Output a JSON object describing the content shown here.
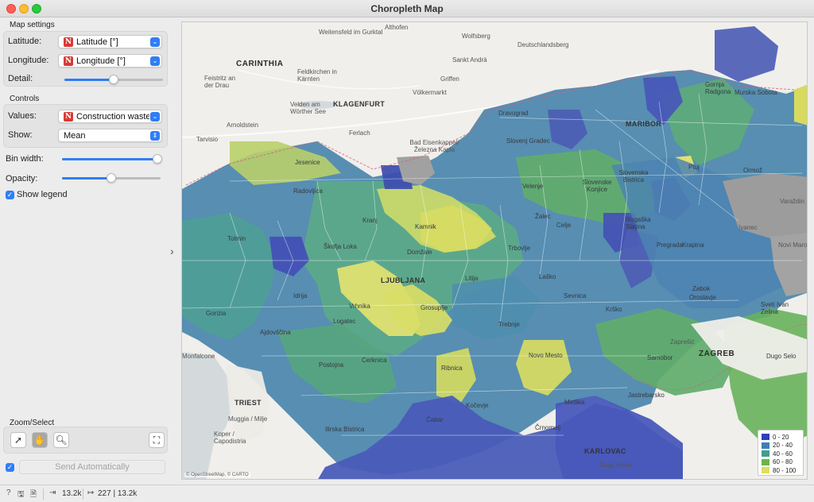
{
  "window": {
    "title": "Choropleth Map"
  },
  "map_settings": {
    "group_label": "Map settings",
    "latitude_label": "Latitude:",
    "latitude_value": "Latitude [°]",
    "longitude_label": "Longitude:",
    "longitude_value": "Longitude [°]",
    "detail_label": "Detail:",
    "detail_level": 0.48,
    "variable_type_badge": "N"
  },
  "controls": {
    "group_label": "Controls",
    "values_label": "Values:",
    "values_value": "Construction waste [",
    "show_label": "Show:",
    "show_value": "Mean"
  },
  "bin_width": {
    "label": "Bin width:",
    "level": 0.98
  },
  "opacity": {
    "label": "Opacity:",
    "level": 0.5
  },
  "show_legend": {
    "label": "Show legend",
    "checked": true
  },
  "zoom_select": {
    "label": "Zoom/Select",
    "active_tool": "pan"
  },
  "send": {
    "label": "Send Automatically",
    "checked": true
  },
  "status": {
    "input_count": "13.2k",
    "output_count": "227 | 13.2k"
  },
  "map": {
    "labels": {
      "weitensfeld": "Weitensfeld im Gurktal",
      "althofen": "Althofen",
      "wolfsberg": "Wolfsberg",
      "eibiswald": "Deutschlandsberg",
      "carinthia": "CARINTHIA",
      "sanktandra": "Sankt Andrä",
      "feistritz": "Feistritz an der Drau",
      "feldkirchen": "Feldkirchen in Kärnten",
      "griffen": "Griffen",
      "volkermarkt": "Völkermarkt",
      "velden": "Velden am Wörther See",
      "klagenfurt": "KLAGENFURT",
      "arnoldstein": "Arnoldstein",
      "ferlach": "Ferlach",
      "bad_eisenkappel": "Bad Eisenkappel/ Železna Kapla",
      "tarvisio": "Tarvisio",
      "dravograd": "Dravograd",
      "maribor": "MARIBOR",
      "murska": "Murska Sobota",
      "gornja": "Gornja Radgona",
      "ptuj": "Ptuj",
      "ormoz": "Ormož",
      "slovenj": "Slovenj Gradec",
      "velenje": "Velenje",
      "slovenska_bistrica": "Slovenska Bistrica",
      "slovenske_konjice": "Slovenske Konjice",
      "zalec": "Žalec",
      "celje": "Celje",
      "rogaska": "Rogaška Slatina",
      "varazdin": "Varaždin",
      "ivanec": "Ivanec",
      "pregrada": "Pregrada",
      "krapina": "Krapina",
      "novi_marof": "Novi Marof",
      "kranj": "Kranj",
      "radovljica": "Radovljica",
      "jesenice": "Jesenice",
      "tolmin": "Tolmin",
      "skofja": "Škofja Loka",
      "kamnik": "Kamnik",
      "domzale": "Domžale",
      "ljubljana": "LJUBLJANA",
      "litija": "Litija",
      "trbovlje": "Trbovlje",
      "lasko": "Laško",
      "sevnica": "Sevnica",
      "krsko": "Krško",
      "zabok": "Zabok",
      "oroslavje": "Oroslavje",
      "sveti_ivan": "Sveti Ivan Zelina",
      "idrija": "Idrija",
      "vrhnika": "Vrhnika",
      "logatec": "Logatec",
      "grosuplje": "Grosuplje",
      "trebnje": "Trebnje",
      "gorizia": "Gorizia",
      "ajdovscina": "Ajdovščina",
      "novo_mesto": "Novo Mesto",
      "zapresic": "Zaprešić",
      "zagreb": "ZAGREB",
      "dugo_selo": "Dugo Selo",
      "monfalcone": "Monfalcone",
      "postojna": "Postojna",
      "cerknica": "Cerknica",
      "ribnica": "Ribnica",
      "samobor": "Samobor",
      "triest": "TRIEST",
      "muggia": "Muggia / Milje",
      "koper": "Koper / Capodistria",
      "ilirska": "Ilirska Bistrica",
      "cabar": "Čabar",
      "kocevje": "Kočevje",
      "metlika": "Metlika",
      "jastrebarsko": "Jastrebarsko",
      "crnomelj": "Črnomelj",
      "karlovac": "KARLOVAC",
      "duga_resa": "Duga Resa"
    },
    "attribution": "© OpenStreetMap, © CARTO"
  },
  "legend": {
    "items": [
      {
        "label": "0 - 20",
        "color": "#2f3fb6"
      },
      {
        "label": "20 - 40",
        "color": "#3c7fb4"
      },
      {
        "label": "40 - 60",
        "color": "#3e9f8c"
      },
      {
        "label": "60 - 80",
        "color": "#6db447"
      },
      {
        "label": "80 - 100",
        "color": "#dede5c"
      }
    ]
  },
  "colors": {
    "accent": "#2f7ef6",
    "nan_region": "#9c9c9c"
  }
}
